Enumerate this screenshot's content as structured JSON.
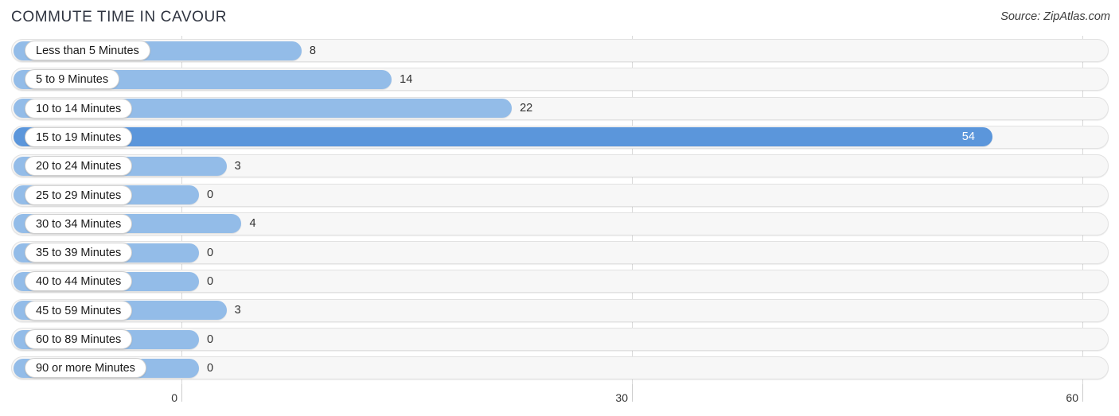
{
  "header": {
    "title": "COMMUTE TIME IN CAVOUR",
    "source": "Source: ZipAtlas.com"
  },
  "chart_data": {
    "type": "bar",
    "orientation": "horizontal",
    "title": "COMMUTE TIME IN CAVOUR",
    "xlabel": "",
    "ylabel": "",
    "xlim": [
      0,
      60
    ],
    "grid": true,
    "legend": "none",
    "xticks": [
      "0",
      "30",
      "60"
    ],
    "xtick_values": [
      0,
      30,
      60
    ],
    "categories": [
      "Less than 5 Minutes",
      "5 to 9 Minutes",
      "10 to 14 Minutes",
      "15 to 19 Minutes",
      "20 to 24 Minutes",
      "25 to 29 Minutes",
      "30 to 34 Minutes",
      "35 to 39 Minutes",
      "40 to 44 Minutes",
      "45 to 59 Minutes",
      "60 to 89 Minutes",
      "90 or more Minutes"
    ],
    "values": [
      8,
      14,
      22,
      54,
      3,
      0,
      4,
      0,
      0,
      3,
      0,
      0
    ],
    "value_labels": [
      "8",
      "14",
      "22",
      "54",
      "3",
      "0",
      "4",
      "0",
      "0",
      "3",
      "0",
      "0"
    ],
    "highlight_index": 3,
    "colors": {
      "bar": "#93bce8",
      "bar_highlight": "#5b96db",
      "track": "#f7f7f7",
      "track_border": "#e2e2e2",
      "gridline": "#d9d9d9",
      "title_text": "#2f3440",
      "label_text": "#1a1a1a",
      "value_text": "#303030",
      "value_text_inside": "#ffffff"
    }
  }
}
